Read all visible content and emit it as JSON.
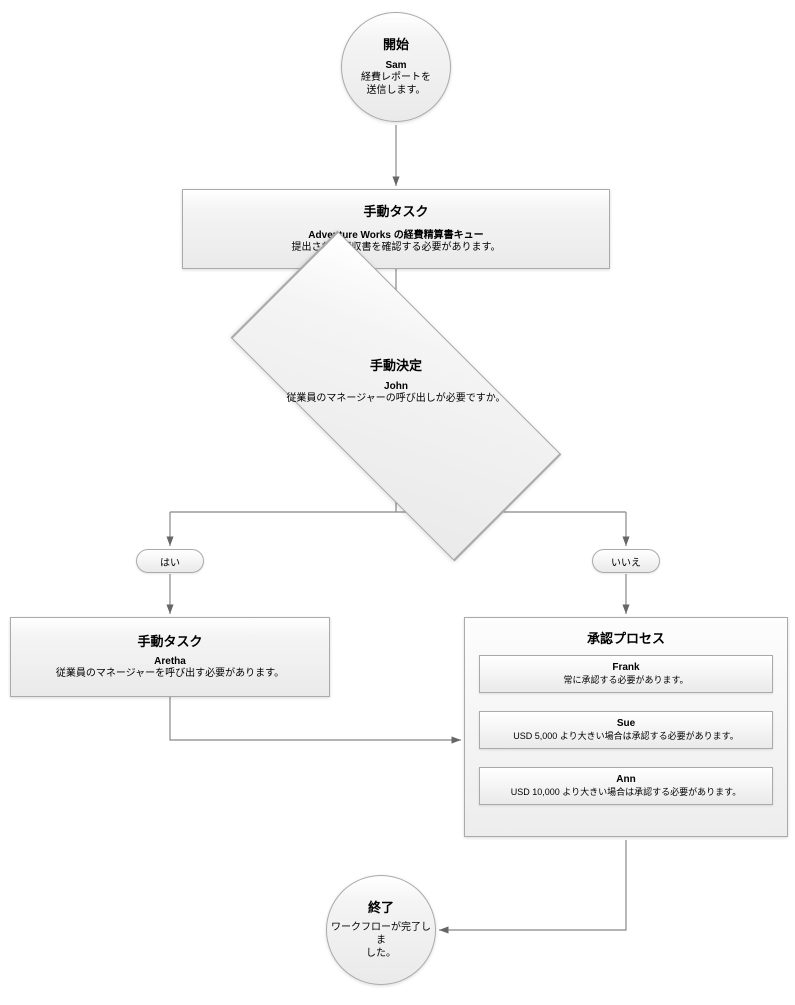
{
  "start": {
    "title": "開始",
    "person": "Sam",
    "desc": "経費レポートを\n送信します。"
  },
  "task1": {
    "title": "手動タスク",
    "person": "Adventure Works の経費精算書キュー",
    "desc": "提出された領収書を確認する必要があります。"
  },
  "decision": {
    "title": "手動決定",
    "person": "John",
    "desc": "従業員のマネージャーの呼び出しが必要ですか。"
  },
  "branch": {
    "yes": "はい",
    "no": "いいえ"
  },
  "task2": {
    "title": "手動タスク",
    "person": "Aretha",
    "desc": "従業員のマネージャーを呼び出す必要があります。"
  },
  "approval": {
    "title": "承認プロセス",
    "steps": [
      {
        "name": "Frank",
        "desc": "常に承認する必要があります。"
      },
      {
        "name": "Sue",
        "desc": "USD 5,000 より大きい場合は承認する必要があります。"
      },
      {
        "name": "Ann",
        "desc": "USD 10,000 より大きい場合は承認する必要があります。"
      }
    ]
  },
  "end": {
    "title": "終了",
    "desc": "ワークフローが完了しま\nした。"
  }
}
